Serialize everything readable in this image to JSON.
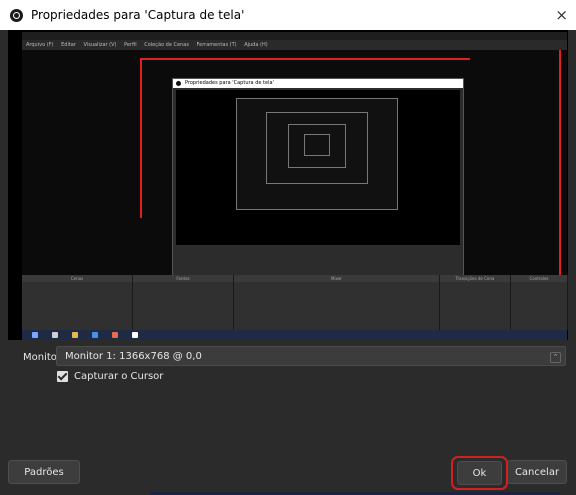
{
  "window": {
    "title": "Propriedades para 'Captura de tela'",
    "close_glyph": "×",
    "icon": "obs-logo-icon"
  },
  "preview": {
    "menu_items": [
      "Arquivo (F)",
      "Editar",
      "Visualizar (V)",
      "Perfil",
      "Coleção de Cenas",
      "Ferramentas (T)",
      "Ajuda (H)"
    ],
    "docks": [
      "Cenas",
      "Fontes",
      "Mixer",
      "Transições de Cena",
      "Controles"
    ]
  },
  "monitor": {
    "label": "Monitor",
    "value": "Monitor 1: 1366x768 @ 0,0",
    "chevron": "⌃"
  },
  "capture_cursor": {
    "label": "Capturar o Cursor",
    "checked": true
  },
  "buttons": {
    "defaults": "Padrões",
    "ok": "Ok",
    "cancel": "Cancelar"
  },
  "colors": {
    "background": "#2b2b2b",
    "highlight": "#d0201f",
    "taskbar": "#1f2a44"
  }
}
